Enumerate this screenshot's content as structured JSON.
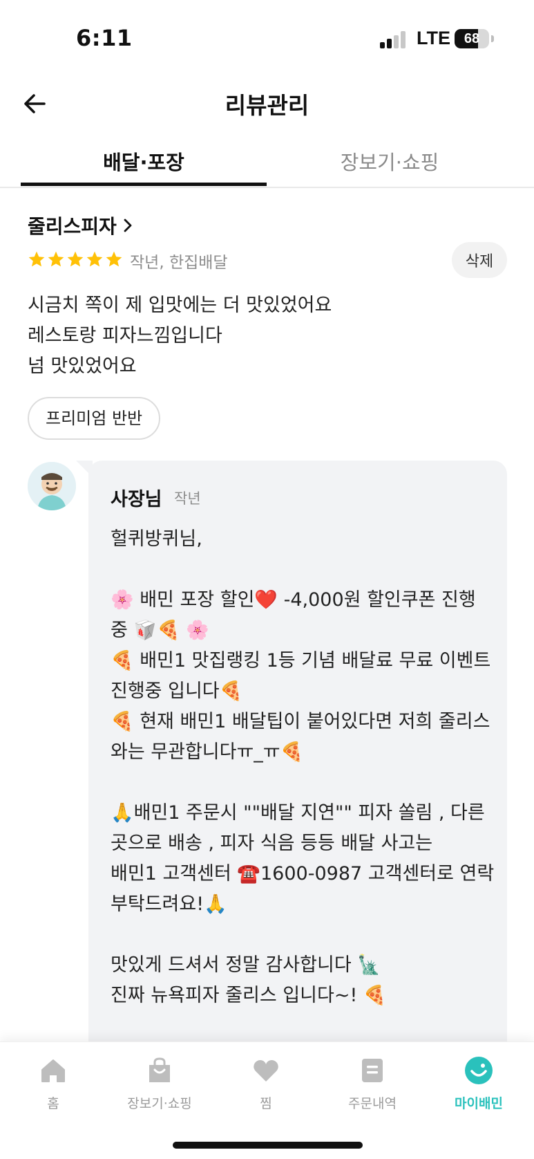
{
  "status_bar": {
    "time": "6:11",
    "network": "LTE",
    "battery": "68",
    "battery_level": 0.68,
    "signal_bars_active": 2,
    "signal_bars_total": 4
  },
  "header": {
    "title": "리뷰관리",
    "back_icon": "arrow-left-icon"
  },
  "tabs": [
    {
      "label": "배달·포장",
      "active": true
    },
    {
      "label": "장보기·쇼핑",
      "active": false
    }
  ],
  "review": {
    "store_name": "줄리스피자",
    "rating": 5,
    "meta": "작년, 한집배달",
    "delete_label": "삭제",
    "text_lines": [
      "시금치 쪽이 제 입맛에는 더 맛있었어요",
      "레스토랑 피자느낌입니다",
      "넘 맛있었어요"
    ],
    "menu_chip": "프리미엄 반반"
  },
  "owner_reply": {
    "name": "사장님",
    "time": "작년",
    "text": "헐퀴방퀴님,\n\n🌸 배민 포장 할인❤️ -4,000원 할인쿠폰 진행 중 🥡🍕 🌸\n🍕 배민1 맛집랭킹 1등 기념 배달료 무료 이벤트 진행중 입니다🍕\n🍕 현재 배민1 배달팁이 붙어있다면 저희 줄리스와는 무관합니다ㅠ_ㅠ🍕\n\n🙏배민1 주문시 \"\"배달 지연\"\" 피자 쏠림 , 다른곳으로 배송 , 피자 식음 등등 배달 사고는\n배민1 고객센터 ☎️1600-0987 고객센터로 연락 부탁드려요!🙏\n\n맛있게 드셔서 정말 감사합니다 🗽\n진짜 뉴욕피자 줄리스 입니다~! 🍕"
  },
  "bottom_nav": [
    {
      "label": "홈",
      "icon": "home-icon",
      "active": false
    },
    {
      "label": "장보기·쇼핑",
      "icon": "shopping-bag-icon",
      "active": false
    },
    {
      "label": "찜",
      "icon": "heart-icon",
      "active": false
    },
    {
      "label": "주문내역",
      "icon": "receipt-icon",
      "active": false
    },
    {
      "label": "마이배민",
      "icon": "smile-face-icon",
      "active": true
    }
  ],
  "colors": {
    "accent": "#2ac1bc",
    "star": "#ffc107",
    "muted": "#8c8c8c"
  }
}
